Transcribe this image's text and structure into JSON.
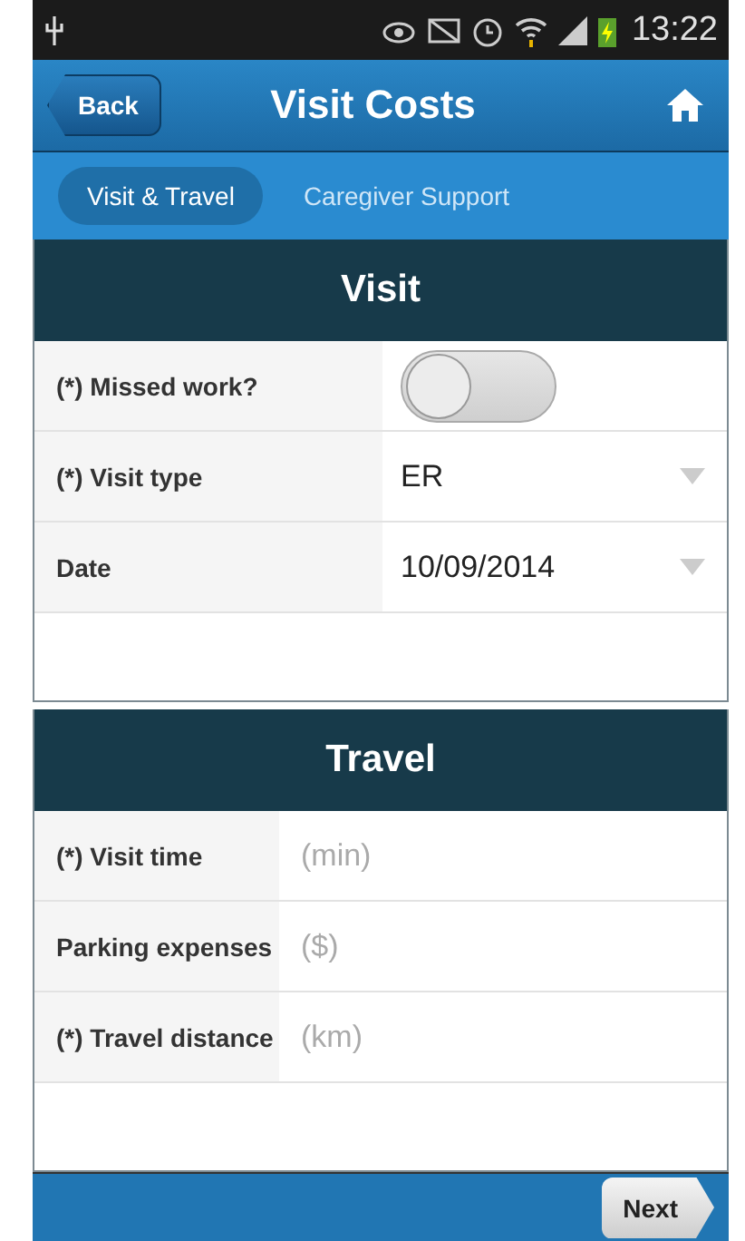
{
  "status_bar": {
    "time": "13:22"
  },
  "header": {
    "back": "Back",
    "title": "Visit Costs"
  },
  "tabs": [
    {
      "label": "Visit & Travel",
      "selected": true
    },
    {
      "label": "Caregiver Support",
      "selected": false
    }
  ],
  "sections": [
    {
      "title": "Visit",
      "rows": [
        {
          "kind": "toggle",
          "label": "(*) Missed work?",
          "on": false
        },
        {
          "kind": "select",
          "label": "(*) Visit type",
          "value": "ER"
        },
        {
          "kind": "select",
          "label": "Date",
          "value": "10/09/2014"
        }
      ]
    },
    {
      "title": "Travel",
      "rows": [
        {
          "kind": "input",
          "label": "(*) Visit time",
          "placeholder": "(min)"
        },
        {
          "kind": "input",
          "label": "Parking expenses",
          "placeholder": "($)"
        },
        {
          "kind": "input",
          "label": "(*) Travel distance",
          "placeholder": "(km)"
        }
      ]
    }
  ],
  "footer": {
    "next": "Next"
  }
}
